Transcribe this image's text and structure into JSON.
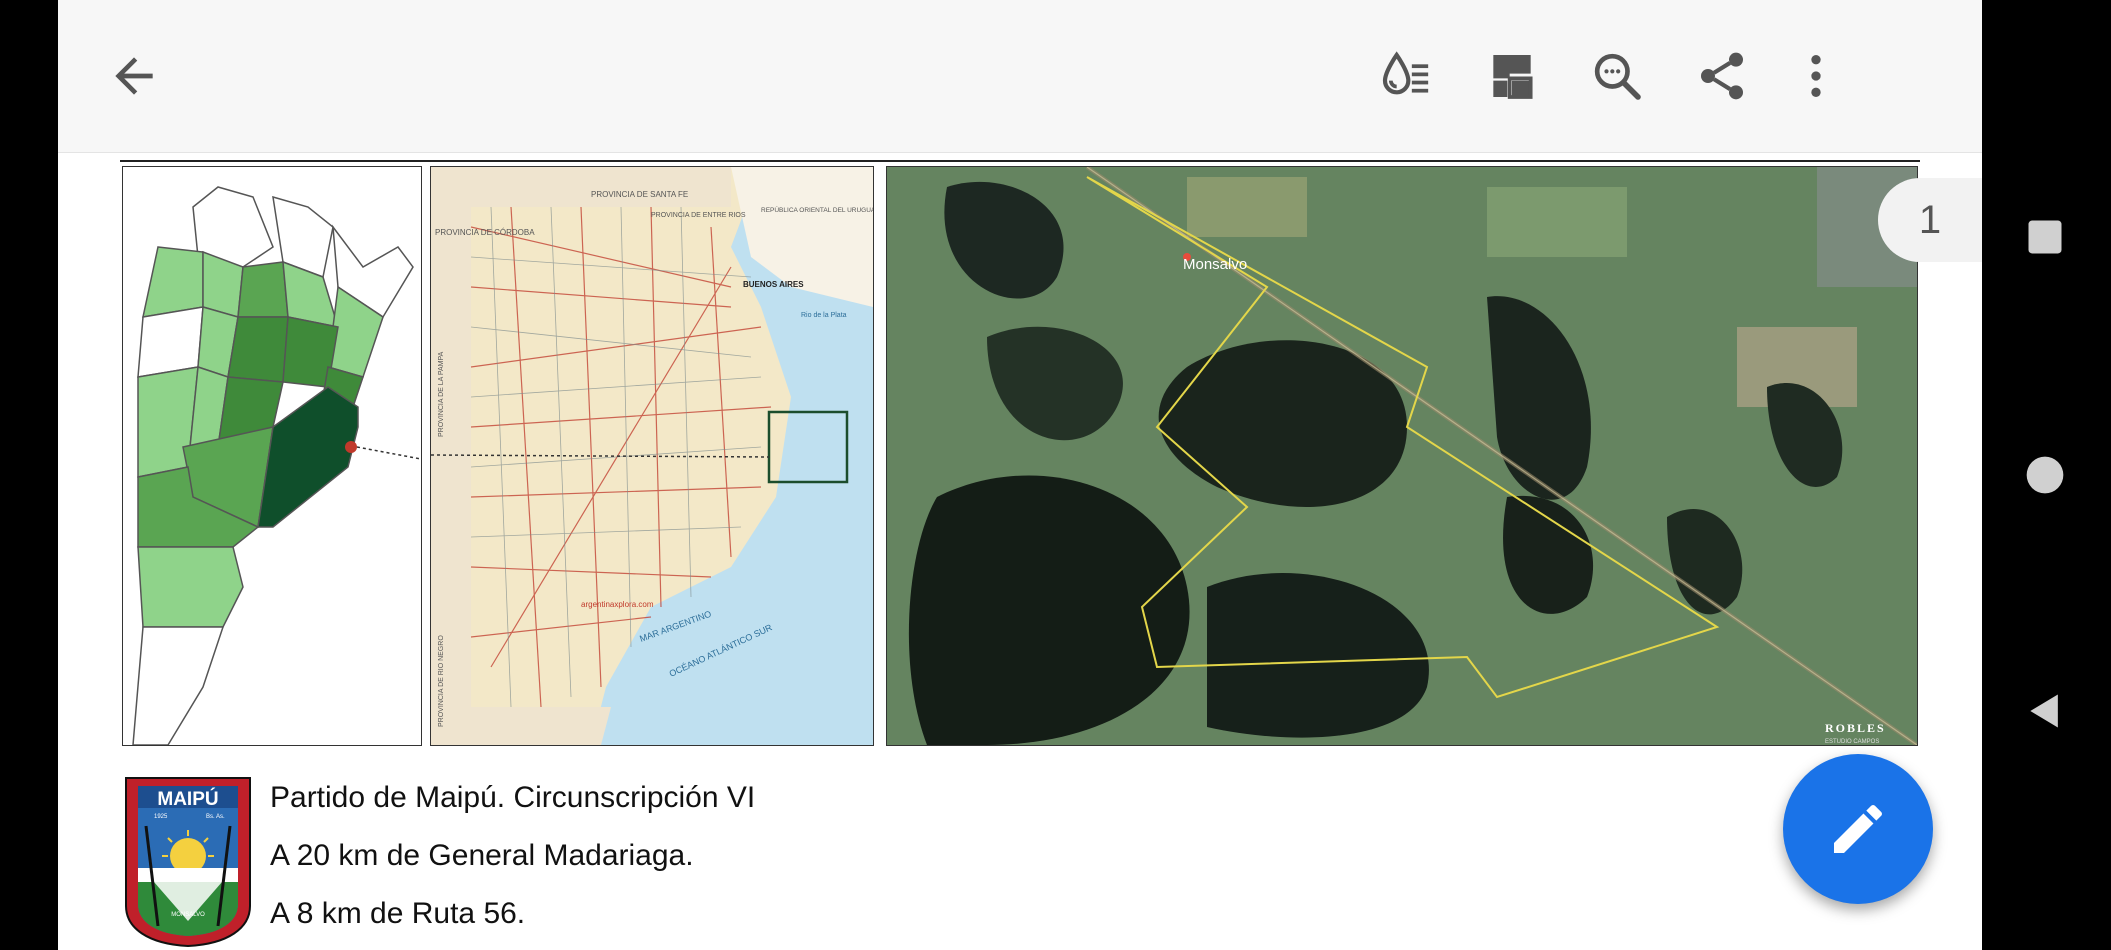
{
  "page": {
    "number": "1"
  },
  "map_labels": {
    "monsalvo": "Monsalvo",
    "buenos_aires": "BUENOS AIRES",
    "provincia_santa_fe": "PROVINCIA DE SANTA FE",
    "provincia_cordoba": "PROVINCIA DE CÓRDOBA",
    "provincia_entre_rios": "PROVINCIA DE ENTRE RIOS",
    "republica_uruguay": "REPÚBLICA ORIENTAL DEL URUGUAY",
    "rio_plata": "Rio de la Plata",
    "mar_argentino": "MAR ARGENTINO",
    "oceano_atlantico": "OCÉANO ATLÁNTICO SUR",
    "provincia_la_pampa": "PROVINCIA DE LA PAMPA",
    "provincia_rio_negro": "PROVINCIA DE RIO NEGRO",
    "website": "argentinaxplora.com",
    "robles": "ROBLES",
    "robles_sub": "ESTUDIO CAMPOS"
  },
  "crest": {
    "name": "MAIPÚ",
    "year": "1925",
    "province": "Bs. As.",
    "locality": "MONSALVO"
  },
  "info": {
    "lines": [
      "Partido de Maipú. Circunscripción VI",
      "A 20 km de General Madariaga.",
      "A 8 km de Ruta 56."
    ]
  },
  "colors": {
    "fab": "#1a73e8",
    "toolbar": "#f7f7f7",
    "icon": "#555555"
  },
  "icons": [
    "back-arrow-icon",
    "reading-mode-icon",
    "bookmark-icon",
    "search-icon",
    "share-icon",
    "more-vert-icon",
    "edit-pencil-icon",
    "nav-square-icon",
    "nav-circle-icon",
    "nav-triangle-icon"
  ]
}
